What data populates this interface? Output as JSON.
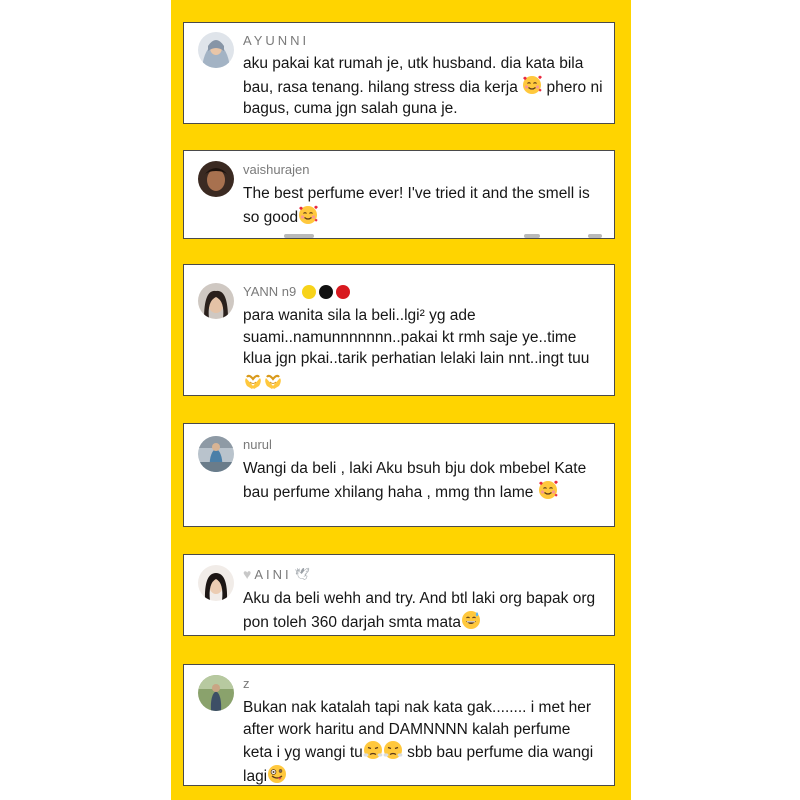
{
  "comments": [
    {
      "username": "AYUNNI",
      "text": "aku pakai kat rumah je, utk husband. dia kata bila bau, rasa tenang. hilang stress dia kerja",
      "text_after": "phero ni bagus, cuma jgn salah guna je.",
      "emojis": [
        "smiling-face-with-hearts-icon"
      ]
    },
    {
      "username": "vaishurajen",
      "text": "The best perfume ever! I've tried it and the smell is so good",
      "emojis": [
        "smiling-face-with-hearts-icon"
      ]
    },
    {
      "username": "YANN n9",
      "badges": [
        {
          "name": "yellow-circle-icon",
          "color": "#F7D31A"
        },
        {
          "name": "black-circle-icon",
          "color": "#111111"
        },
        {
          "name": "red-circle-icon",
          "color": "#D8191F"
        }
      ],
      "text": "para wanita sila la beli..lgi² yg ade suami..namunnnnnnn..pakai kt rmh saje ye..time klua jgn pkai..tarik perhatian lelaki lain nnt..ingt tuu",
      "emojis": [
        "heart-hands-icon",
        "heart-hands-icon"
      ]
    },
    {
      "username": "nurul",
      "text": "Wangi da beli , laki Aku bsuh bju dok mbebel Kate bau perfume xhilang haha , mmg thn lame",
      "emojis": [
        "smiling-face-with-hearts-icon"
      ]
    },
    {
      "username": "AINI",
      "username_prefix_icon": "white-heart-icon",
      "username_suffix_icon": "dove-icon",
      "text": "Aku da beli wehh and try. And btl laki org bapak org pon toleh 360 darjah smta mata",
      "emojis": [
        "grinning-sweat-icon"
      ]
    },
    {
      "username": "z",
      "text": "Bukan nak katalah tapi nak kata gak........ i met her after work haritu and DAMNNNN kalah perfume keta i yg wangi tu",
      "text_after": "sbb bau perfume dia wangi lagi",
      "emojis": [
        "steam-from-nose-icon",
        "steam-from-nose-icon",
        "zany-face-icon"
      ]
    }
  ],
  "colors": {
    "background": "#FFD400",
    "card": "#FFFFFF",
    "username": "#7A7A7A",
    "text": "#161616"
  }
}
